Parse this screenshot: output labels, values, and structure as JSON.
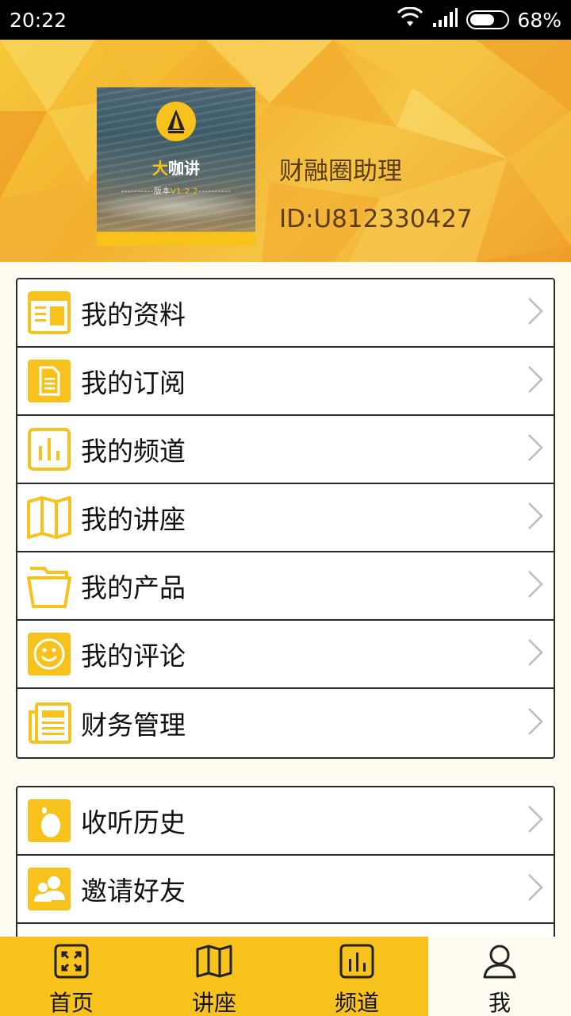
{
  "status_bar": {
    "time": "20:22",
    "battery": "68%",
    "battery_level": 0.68,
    "icons": [
      "wifi-icon",
      "signal-icon",
      "battery-icon"
    ]
  },
  "profile": {
    "avatar_brand_accent": "大",
    "avatar_brand_rest": "咖讲",
    "avatar_version_prefix": "----------版本",
    "avatar_version_value": "V1.2.2",
    "avatar_version_suffix": "----------",
    "name": "财融圈助理",
    "id": "ID:U812330427"
  },
  "menu_group_1": [
    {
      "label": "我的资料",
      "icon": "profile-icon"
    },
    {
      "label": "我的订阅",
      "icon": "document-icon"
    },
    {
      "label": "我的频道",
      "icon": "channel-icon"
    },
    {
      "label": "我的讲座",
      "icon": "map-icon"
    },
    {
      "label": "我的产品",
      "icon": "folder-icon"
    },
    {
      "label": "我的评论",
      "icon": "smiley-icon"
    },
    {
      "label": "财务管理",
      "icon": "newspaper-icon"
    }
  ],
  "menu_group_2": [
    {
      "label": "收听历史",
      "icon": "footprint-icon"
    },
    {
      "label": "邀请好友",
      "icon": "friends-icon"
    }
  ],
  "bottom_nav": [
    {
      "label": "首页",
      "icon": "expand-icon"
    },
    {
      "label": "讲座",
      "icon": "map-icon"
    },
    {
      "label": "频道",
      "icon": "chart-icon"
    },
    {
      "label": "我",
      "icon": "user-icon",
      "active": true
    }
  ],
  "colors": {
    "accent": "#f7c21c",
    "text_dark": "#111111",
    "border": "#2a2a2a",
    "page_bg": "#fffdf2"
  }
}
